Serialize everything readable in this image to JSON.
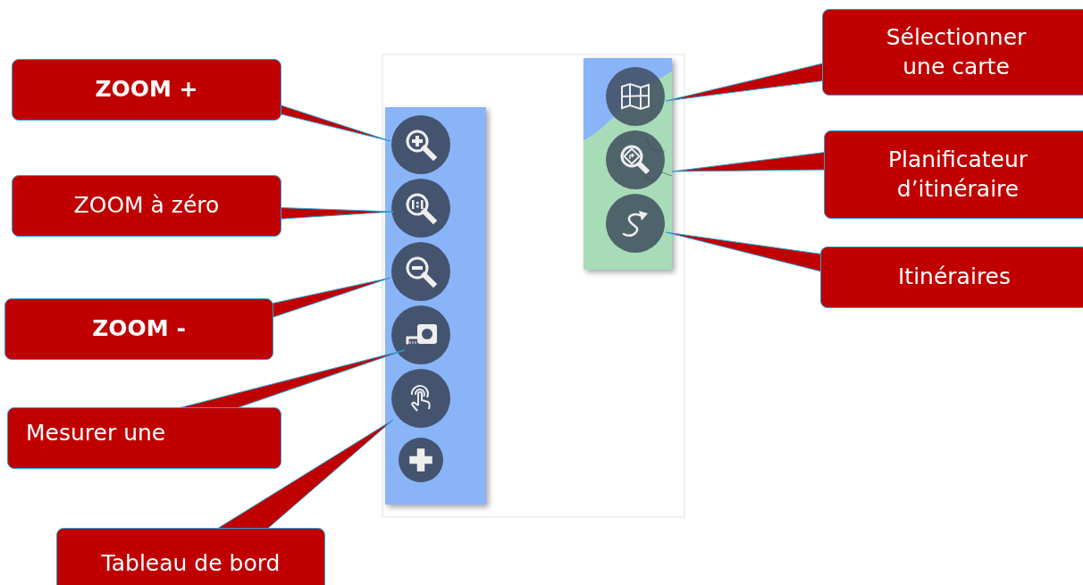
{
  "left_toolbar": {
    "buttons": [
      {
        "kind": "zoom-in"
      },
      {
        "kind": "zoom-reset"
      },
      {
        "kind": "zoom-out"
      },
      {
        "kind": "measure"
      },
      {
        "kind": "touch"
      },
      {
        "kind": "add"
      }
    ]
  },
  "map_panel": {
    "buttons": [
      {
        "kind": "map"
      },
      {
        "kind": "route-planner"
      },
      {
        "kind": "route"
      }
    ]
  },
  "callouts": [
    {
      "text": "ZOOM +",
      "bold": true
    },
    {
      "text": "ZOOM à zéro",
      "bold": false
    },
    {
      "text": "ZOOM -",
      "bold": true
    },
    {
      "text": "Mesurer une",
      "bold": false
    },
    {
      "text": "Tableau de bord",
      "bold": false
    },
    {
      "text": "Sélectionner une carte",
      "bold": false
    },
    {
      "text": "Planificateur d’itinéraire",
      "bold": false
    },
    {
      "text": "Itinéraires",
      "bold": false
    }
  ]
}
